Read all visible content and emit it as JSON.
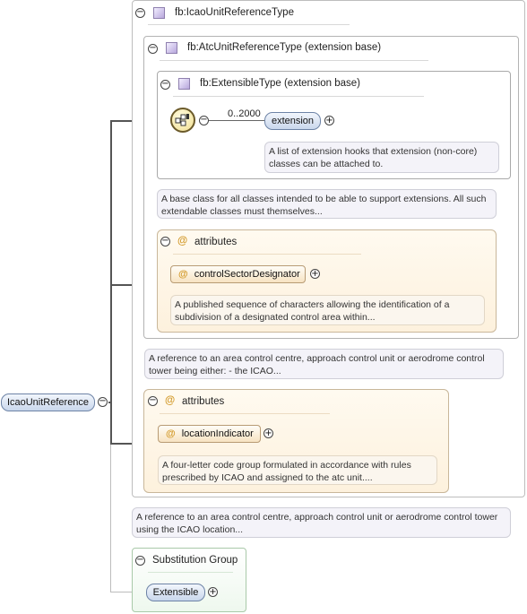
{
  "root_element": "IcaoUnitReference",
  "type_box": {
    "title": "fb:IcaoUnitReferenceType",
    "extension_box": {
      "title": "fb:AtcUnitReferenceType (extension base)",
      "inner_box": {
        "title": "fb:ExtensibleType (extension base)",
        "cardinality": "0..2000",
        "element": "extension",
        "element_doc": "A list of extension hooks that extension (non-core) classes can be attached to."
      },
      "doc": "A base class for all classes intended to be able to support extensions. All such extendable classes must themselves...",
      "attributes": {
        "title": "attributes",
        "attribute": "controlSectorDesignator",
        "doc": "A published sequence of characters allowing the identification of a subdivision of a designated control area within..."
      }
    },
    "extension_doc": "A reference to an area control centre, approach control unit or aerodrome control tower being either: - the ICAO...",
    "attributes": {
      "title": "attributes",
      "attribute": "locationIndicator",
      "doc": "A four-letter code group formulated in accordance with rules prescribed by ICAO and assigned to the atc unit...."
    }
  },
  "type_doc": "A reference to an area control centre, approach control unit or aerodrome control tower using the ICAO location...",
  "substitution_group": {
    "title": "Substitution Group",
    "element": "Extensible"
  },
  "glyphs": {
    "minus": "−",
    "plus": "+",
    "at": "@"
  }
}
